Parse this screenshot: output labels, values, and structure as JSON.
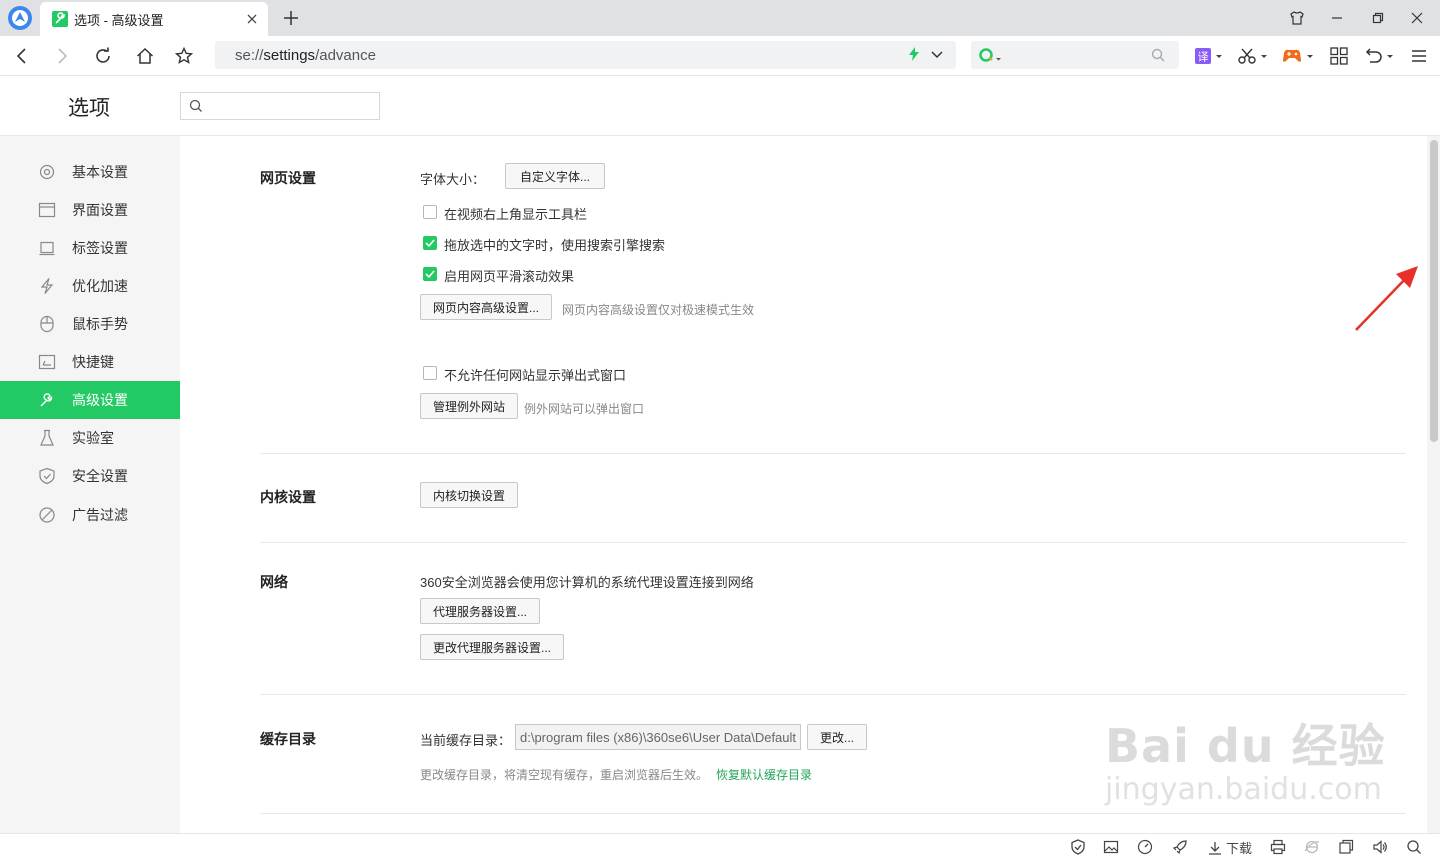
{
  "tab": {
    "title": "选项 - 高级设置"
  },
  "address": {
    "scheme": "se://",
    "host": "settings",
    "path": "/advance"
  },
  "search": {
    "placeholder": ""
  },
  "options": {
    "title": "选项",
    "search_placeholder": ""
  },
  "sidebar": {
    "items": [
      {
        "label": "基本设置",
        "icon": "gear-icon"
      },
      {
        "label": "界面设置",
        "icon": "window-icon"
      },
      {
        "label": "标签设置",
        "icon": "tab-icon"
      },
      {
        "label": "优化加速",
        "icon": "lightning-icon"
      },
      {
        "label": "鼠标手势",
        "icon": "mouse-icon"
      },
      {
        "label": "快捷键",
        "icon": "keyboard-icon"
      },
      {
        "label": "高级设置",
        "icon": "wrench-icon",
        "active": true
      },
      {
        "label": "实验室",
        "icon": "flask-icon"
      },
      {
        "label": "安全设置",
        "icon": "shield-icon"
      },
      {
        "label": "广告过滤",
        "icon": "block-icon"
      }
    ]
  },
  "webpage": {
    "title": "网页设置",
    "font_size_label": "字体大小：",
    "custom_font_button": "自定义字体...",
    "checkbox_video_toolbar": {
      "label": "在视频右上角显示工具栏",
      "checked": false
    },
    "checkbox_drag_search": {
      "label": "拖放选中的文字时，使用搜索引擎搜索",
      "checked": true
    },
    "checkbox_smooth_scroll": {
      "label": "启用网页平滑滚动效果",
      "checked": true
    },
    "advanced_content_button": "网页内容高级设置...",
    "advanced_content_hint": "网页内容高级设置仅对极速模式生效",
    "checkbox_block_popups": {
      "label": "不允许任何网站显示弹出式窗口",
      "checked": false
    },
    "manage_exceptions_button": "管理例外网站",
    "manage_exceptions_hint": "例外网站可以弹出窗口"
  },
  "kernel": {
    "title": "内核设置",
    "switch_button": "内核切换设置"
  },
  "network": {
    "title": "网络",
    "description": "360安全浏览器会使用您计算机的系统代理设置连接到网络",
    "proxy_button": "代理服务器设置...",
    "change_proxy_button": "更改代理服务器设置..."
  },
  "cache": {
    "title": "缓存目录",
    "current_label": "当前缓存目录：",
    "path": "d:\\program files (x86)\\360se6\\User Data\\Default",
    "change_button": "更改...",
    "hint": "更改缓存目录，将清空现有缓存，重启浏览器后生效。",
    "restore_link": "恢复默认缓存目录"
  },
  "statusbar": {
    "download_label": "下载"
  },
  "watermark": {
    "logo": "Bai du 经验",
    "url": "jingyan.baidu.com"
  },
  "colors": {
    "accent": "#23c965",
    "annotation_arrow": "#e8302a"
  }
}
